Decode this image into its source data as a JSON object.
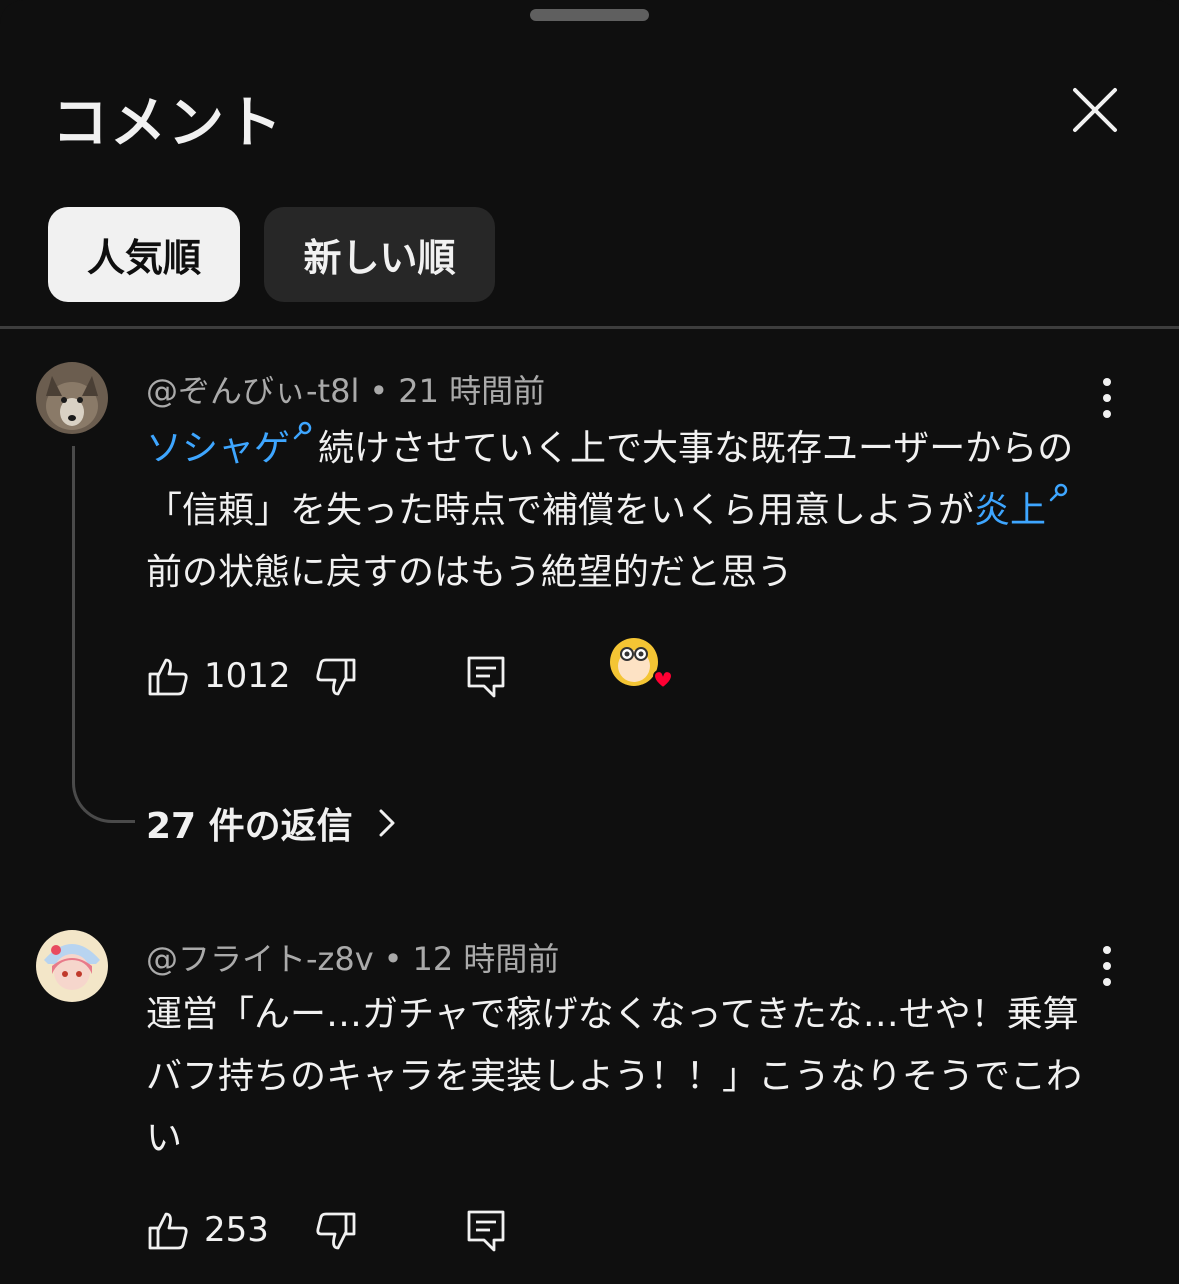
{
  "header": {
    "title": "コメント"
  },
  "sort": {
    "popular": "人気順",
    "newest": "新しい順"
  },
  "comments": [
    {
      "author": "@ぞんびぃ-t8l",
      "time": "21 時間前",
      "body": {
        "link1": "ソシャゲ",
        "seg1": "続けさせていく上で大事な既存ユーザーからの「信頼」を失った時点で補償をいくら用意しようが",
        "link2": "炎上",
        "seg2": "前の状態に戻すのはもう絶望的だと思う"
      },
      "likes": "1012",
      "replies": "27 件の返信"
    },
    {
      "author": "@フライト-z8v",
      "time": "12 時間前",
      "body": {
        "text": "運営「んー…ガチャで稼げなくなってきたな…せや！乗算バフ持ちのキャラを実装しよう！！」こうなりそうでこわい"
      },
      "likes": "253"
    }
  ],
  "colors": {
    "background": "#0f0f0f",
    "link": "#3ea6ff",
    "heart": "#ff0033",
    "chip_active": "#f1f1f1",
    "chip_inactive": "#272727"
  },
  "icons": [
    "close-icon",
    "more-vert-icon",
    "thumb-up-icon",
    "thumb-down-icon",
    "reply-icon",
    "search-icon",
    "creator-heart-icon",
    "chevron-right-icon"
  ]
}
